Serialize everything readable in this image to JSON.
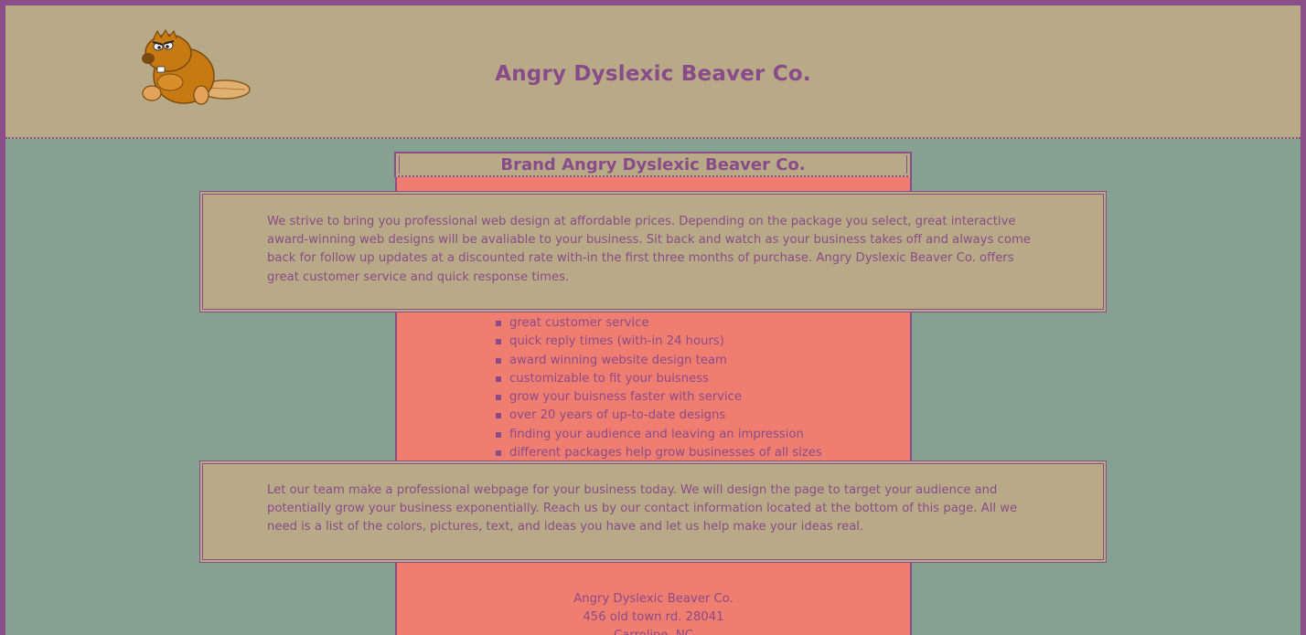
{
  "header": {
    "title": "Angry Dyslexic Beaver Co.",
    "logo_icon": "beaver-logo-icon"
  },
  "brand": {
    "title": "Brand Angry Dyslexic Beaver Co."
  },
  "intro": {
    "text": "We strive to bring you professional web design at affordable prices. Depending on the package you select, great interactive award-winning web designs will be avaliable to your business. Sit back and watch as your business takes off and always come back for follow up updates at a discounted rate with-in the first three months of purchase. Angry Dyslexic Beaver Co. offers great customer service and quick response times."
  },
  "features": [
    "great customer service",
    "quick reply times (with-in 24 hours)",
    "award winning website design team",
    "customizable to fit your buisness",
    "grow your buisness faster with service",
    "over 20 years of up-to-date designs",
    "finding your audience and leaving an impression",
    "different packages help grow businesses of all sizes"
  ],
  "cta": {
    "text": "Let our team make a professional webpage for your business today. We will design the page to target your audience and potentially grow your business exponentially. Reach us by our contact information located at the bottom of this page. All we need is a list of the colors, pictures, text, and ideas you have and let us help make your ideas real."
  },
  "contact": {
    "name": "Angry Dyslexic Beaver Co.",
    "address": "456 old town rd. 28041",
    "city": "Carroline, NC"
  },
  "colors": {
    "header_bg": "#b8aa87",
    "page_bg": "#86a092",
    "accent": "#8a4f88",
    "center_bg": "#f07e70"
  }
}
